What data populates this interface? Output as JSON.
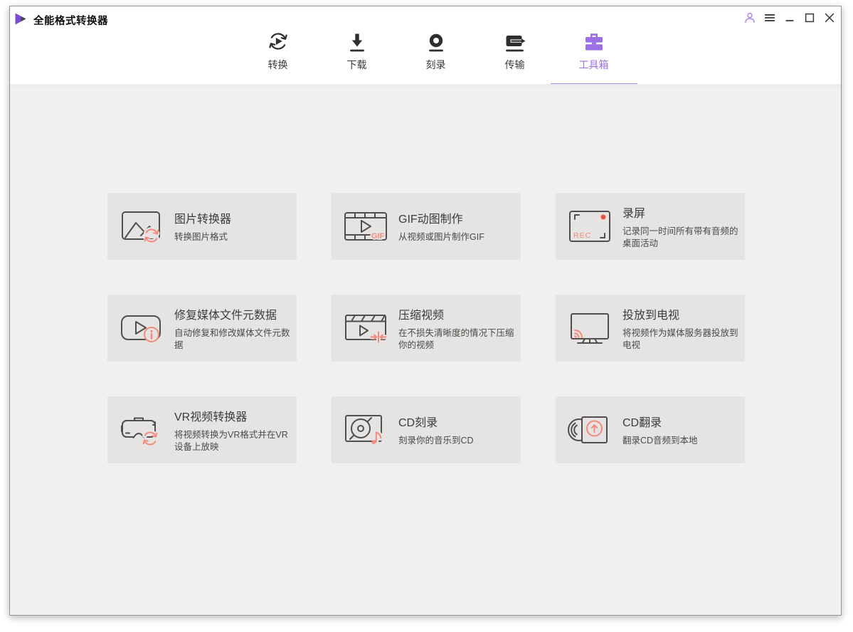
{
  "colors": {
    "accent_purple": "#9c6fe4",
    "underline_purple": "#a98de9",
    "salmon": "#f5897c",
    "record_red": "#ee5045",
    "icon_stroke": "#514f4d",
    "nav_icon_dark": "#2e2e2e",
    "header_bg": "#ffffff",
    "content_bg": "#f1f0ee",
    "card_bg": "#e6e4e2"
  },
  "titlebar": {
    "app_title": "全能格式转换器",
    "logo_icon": "play-logo-icon",
    "controls": [
      {
        "name": "account",
        "icon": "user-icon"
      },
      {
        "name": "menu",
        "icon": "hamburger-icon"
      },
      {
        "name": "minimize",
        "icon": "minimize-icon"
      },
      {
        "name": "maximize",
        "icon": "maximize-icon"
      },
      {
        "name": "close",
        "icon": "close-icon"
      }
    ]
  },
  "nav": {
    "tabs": [
      {
        "label": "转换",
        "icon": "convert-icon",
        "active": false
      },
      {
        "label": "下载",
        "icon": "download-icon",
        "active": false
      },
      {
        "label": "刻录",
        "icon": "burn-icon",
        "active": false
      },
      {
        "label": "传输",
        "icon": "transfer-icon",
        "active": false
      },
      {
        "label": "工具箱",
        "icon": "toolbox-icon",
        "active": true
      }
    ]
  },
  "toolbox": {
    "cards": [
      {
        "title": "图片转换器",
        "desc": "转换图片格式",
        "icon": "image-converter-icon"
      },
      {
        "title": "GIF动图制作",
        "desc": "从视频或图片制作GIF",
        "icon": "gif-maker-icon",
        "icon_text": "GIF"
      },
      {
        "title": "录屏",
        "desc": "记录同一时间所有带有音频的桌面活动",
        "icon": "screen-record-icon",
        "icon_text": "REC"
      },
      {
        "title": "修复媒体文件元数据",
        "desc": "自动修复和修改媒体文件元数据",
        "icon": "fix-metadata-icon"
      },
      {
        "title": "压缩视频",
        "desc": "在不损失清晰度的情况下压缩你的视频",
        "icon": "compress-video-icon"
      },
      {
        "title": "投放到电视",
        "desc": "将视频作为媒体服务器投放到电视",
        "icon": "cast-to-tv-icon"
      },
      {
        "title": "VR视频转换器",
        "desc": "将视频转换为VR格式并在VR设备上放映",
        "icon": "vr-converter-icon"
      },
      {
        "title": "CD刻录",
        "desc": "刻录你的音乐到CD",
        "icon": "cd-burn-icon"
      },
      {
        "title": "CD翻录",
        "desc": "翻录CD音频到本地",
        "icon": "cd-rip-icon"
      }
    ]
  }
}
